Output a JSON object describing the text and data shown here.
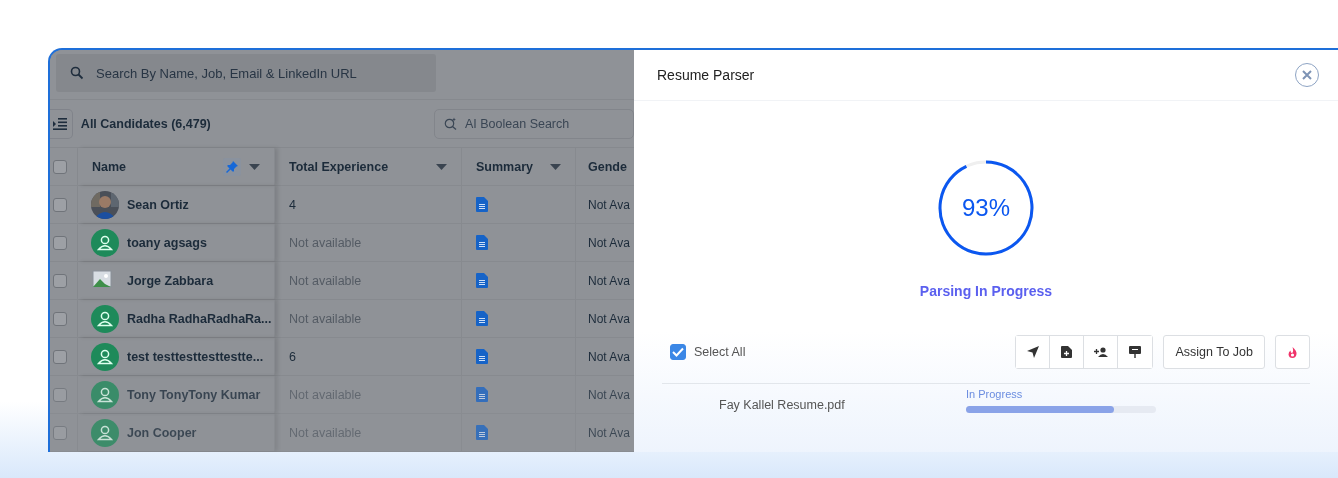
{
  "search": {
    "placeholder": "Search By Name, Job, Email & LinkedIn URL"
  },
  "list_title": "All Candidates (6,479)",
  "ai_search": {
    "placeholder": "AI Boolean Search"
  },
  "table": {
    "select_all_checked": false,
    "columns": [
      {
        "label": "Name",
        "pinned": true,
        "sortable": true
      },
      {
        "label": "Total Experience",
        "pinned": false,
        "sortable": true
      },
      {
        "label": "Summary",
        "pinned": false,
        "sortable": true
      },
      {
        "label": "Gende",
        "pinned": false,
        "sortable": false
      }
    ],
    "rows": [
      {
        "name": "Sean Ortiz",
        "experience": "4",
        "experience_missing": false,
        "gender": "Not Ava",
        "checked": false
      },
      {
        "name": "toany agsags",
        "kind": "default",
        "experience": "Not available",
        "experience_missing": true,
        "gender": "Not Ava",
        "checked": false
      },
      {
        "name": "Jorge Zabbara",
        "kind": "broken",
        "experience": "Not available",
        "experience_missing": true,
        "gender": "Not Ava",
        "checked": false
      },
      {
        "name": "Radha RadhaRadhaRa...",
        "kind": "default",
        "experience": "Not available",
        "experience_missing": true,
        "gender": "Not Ava",
        "checked": false
      },
      {
        "name": "test testtesttesttestte...",
        "kind": "default",
        "experience": "6",
        "experience_missing": false,
        "gender": "Not Ava",
        "checked": false
      },
      {
        "name": "Tony TonyTony Kumar",
        "kind": "default",
        "experience": "Not available",
        "experience_missing": true,
        "gender": "Not Ava",
        "checked": false
      },
      {
        "name": "Jon Cooper",
        "kind": "default",
        "experience": "Not available",
        "experience_missing": true,
        "gender": "Not Ava",
        "checked": false
      }
    ]
  },
  "parser": {
    "title": "Resume Parser",
    "progress": {
      "level": 0.93,
      "percent": "93%",
      "status": "Parsing In Progress"
    },
    "select_all": {
      "label": "Select All",
      "checked": true
    },
    "actions": [
      {
        "kind": "send"
      },
      {
        "kind": "save"
      },
      {
        "kind": "add-person"
      },
      {
        "kind": "present"
      }
    ],
    "assign_button": "Assign To Job",
    "files": [
      {
        "name": "Fay Kallel Resume.pdf",
        "status": "In Progress",
        "level": 0.78
      }
    ]
  }
}
